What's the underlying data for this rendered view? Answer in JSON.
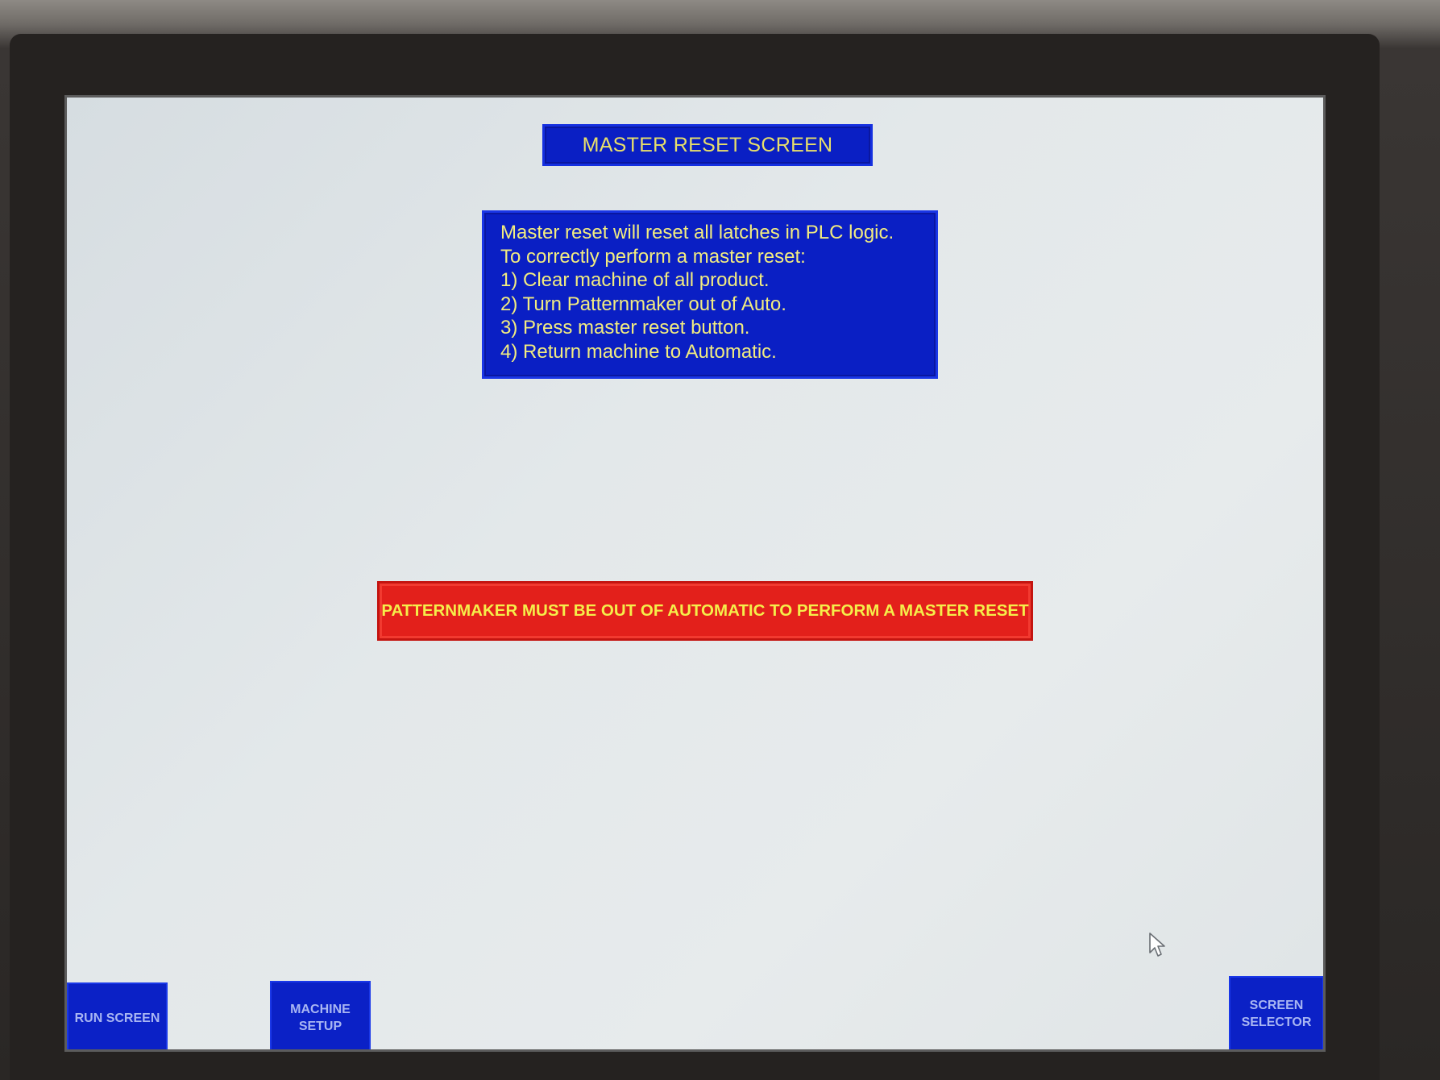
{
  "header": {
    "title": "MASTER RESET SCREEN"
  },
  "instructions": {
    "lines": [
      "Master reset will reset all latches in PLC logic.",
      "To correctly perform a master reset:",
      "1) Clear machine of all product.",
      "2) Turn Patternmaker out of Auto.",
      "3) Press master reset button.",
      "4) Return machine to Automatic."
    ]
  },
  "warning": {
    "text": "PATTERNMAKER MUST BE OUT OF AUTOMATIC TO PERFORM A MASTER RESET"
  },
  "nav": {
    "run_screen": "RUN SCREEN",
    "machine_setup": [
      "MACHINE",
      "SETUP"
    ],
    "screen_selector": [
      "SCREEN",
      "SELECTOR"
    ]
  },
  "colors": {
    "panel_blue": "#0a1fc4",
    "text_yellow": "#f2ec80",
    "warning_red": "#e3201b",
    "warning_text": "#f5ee4a",
    "screen_bg": "#e3e8ea"
  },
  "icons": {
    "cursor": "mouse-pointer-icon"
  }
}
